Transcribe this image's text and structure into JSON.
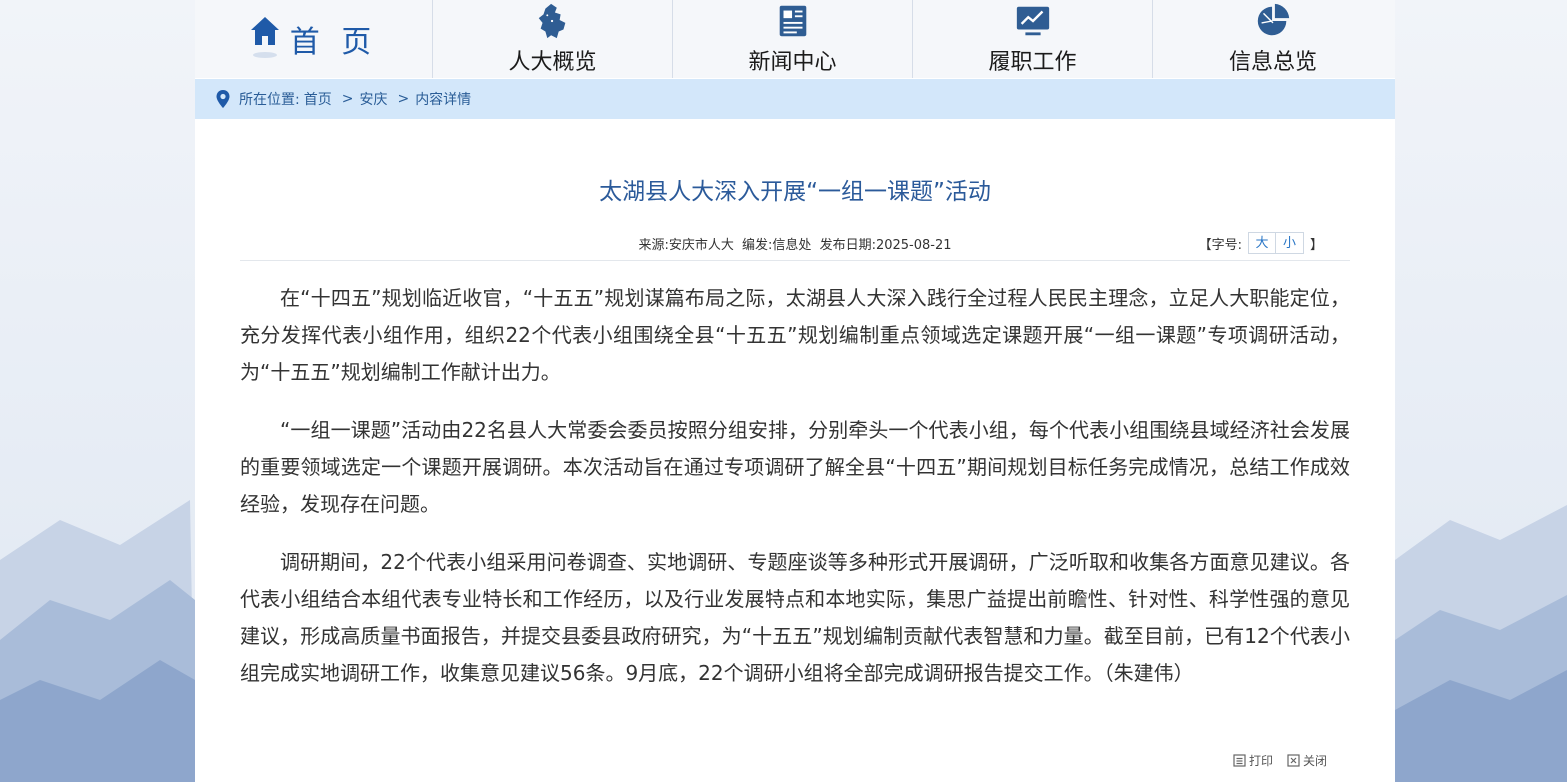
{
  "nav": {
    "home_label": "首 页",
    "items": [
      {
        "label": "人大概览",
        "icon": "anhui-map-icon"
      },
      {
        "label": "新闻中心",
        "icon": "newspaper-icon"
      },
      {
        "label": "履职工作",
        "icon": "chart-monitor-icon"
      },
      {
        "label": "信息总览",
        "icon": "pie-chart-icon"
      }
    ]
  },
  "breadcrumb": {
    "prefix": "所在位置:",
    "items": [
      "首页",
      "安庆",
      "内容详情"
    ],
    "separator": ">"
  },
  "article": {
    "title": "太湖县人大深入开展“一组一课题”活动",
    "source": "来源:安庆市人大",
    "editor": "编发:信息处",
    "date": "发布日期:2025-08-21",
    "font_size_label": "【字号:",
    "font_size_large": "大",
    "font_size_small": "小",
    "font_size_close": "】",
    "paragraphs": [
      "在“十四五”规划临近收官，“十五五”规划谋篇布局之际，太湖县人大深入践行全过程人民民主理念，立足人大职能定位，充分发挥代表小组作用，组织22个代表小组围绕全县“十五五”规划编制重点领域选定课题开展“一组一课题”专项调研活动，为“十五五”规划编制工作献计出力。",
      "“一组一课题”活动由22名县人大常委会委员按照分组安排，分别牵头一个代表小组，每个代表小组围绕县域经济社会发展的重要领域选定一个课题开展调研。本次活动旨在通过专项调研了解全县“十四五”期间规划目标任务完成情况，总结工作成效经验，发现存在问题。",
      "调研期间，22个代表小组采用问卷调查、实地调研、专题座谈等多种形式开展调研，广泛听取和收集各方面意见建议。各代表小组结合本组代表专业特长和工作经历，以及行业发展特点和本地实际，集思广益提出前瞻性、针对性、科学性强的意见建议，形成高质量书面报告，并提交县委县政府研究，为“十五五”规划编制贡献代表智慧和力量。截至目前，已有12个代表小组完成实地调研工作，收集意见建议56条。9月底，22个调研小组将全部完成调研报告提交工作。（朱建伟）"
    ]
  },
  "tools": {
    "print_label": "打印",
    "close_label": "关闭"
  },
  "colors": {
    "nav_blue": "#1f5aa8",
    "title_blue": "#2b5a9a",
    "crumb_bg": "#d3e7fa",
    "link_blue": "#2a76c6"
  }
}
